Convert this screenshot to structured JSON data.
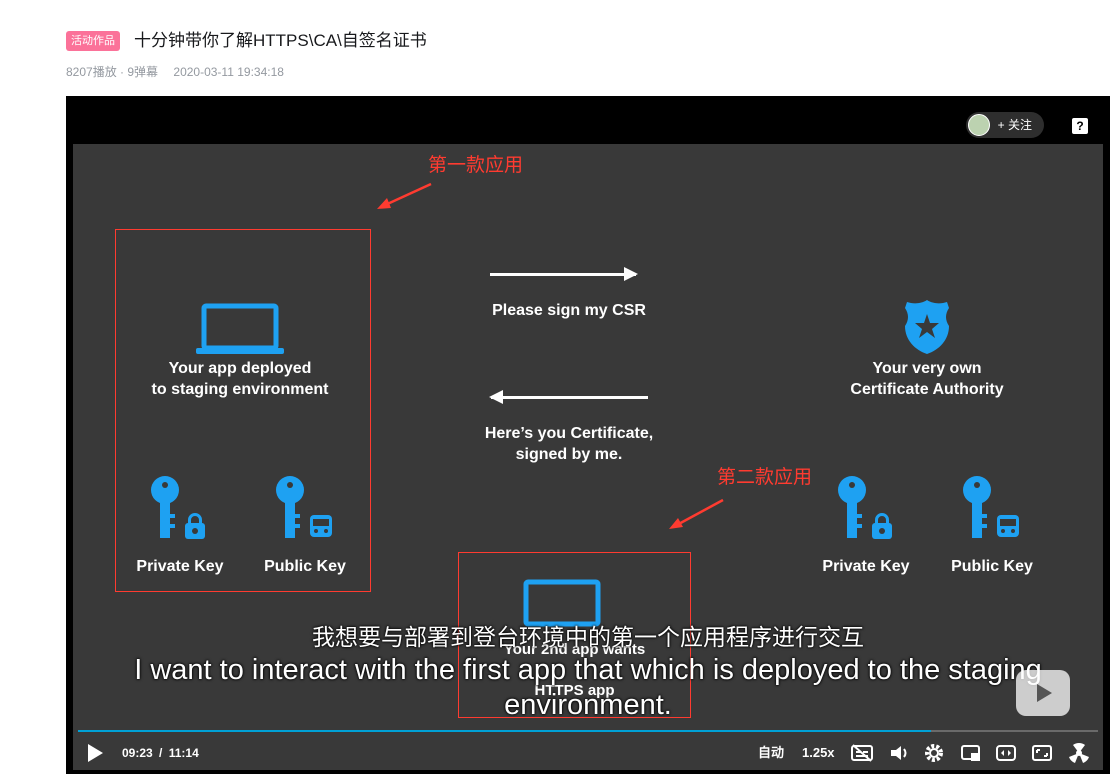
{
  "header": {
    "badge": "活动作品",
    "title": "十分钟带你了解HTTPS\\CA\\自签名证书",
    "plays": "8207播放 · 9弹幕",
    "datetime": "2020-03-11 19:34:18"
  },
  "player": {
    "follow_label": "+ 关注",
    "help_glyph": "?",
    "slide": {
      "app1_title_line1": "Your app deployed",
      "app1_title_line2": "to staging environment",
      "arrow_right_label": "Please sign my CSR",
      "arrow_left_line1": "Here’s you Certificate,",
      "arrow_left_line2": "signed by me.",
      "ca_line1": "Your very own",
      "ca_line2": "Certificate Authority",
      "private_key_left": "Private Key",
      "public_key_left": "Public Key",
      "private_key_right": "Private Key",
      "public_key_right": "Public Key",
      "app2_line1": "Your 2nd app wants",
      "app2_line2": "HTTPS app",
      "note_first_app": "第一款应用",
      "note_second_app": "第二款应用"
    },
    "subtitle_cn": "我想要与部署到登台环境中的第一个应用程序进行交互",
    "subtitle_en_line1": "I want to interact with the first app that which is deployed to the staging",
    "subtitle_en_line2": "environment.",
    "controls": {
      "current_time": "09:23",
      "separator": "/",
      "duration": "11:14",
      "progress": 0.836,
      "quality": "自动",
      "speed": "1.25x"
    },
    "colors": {
      "accent": "#00a1d6",
      "badge": "#fb7299",
      "annotation": "#ff3b30",
      "icon_blue": "#1ea1f2",
      "slide_bg": "#393939"
    }
  }
}
